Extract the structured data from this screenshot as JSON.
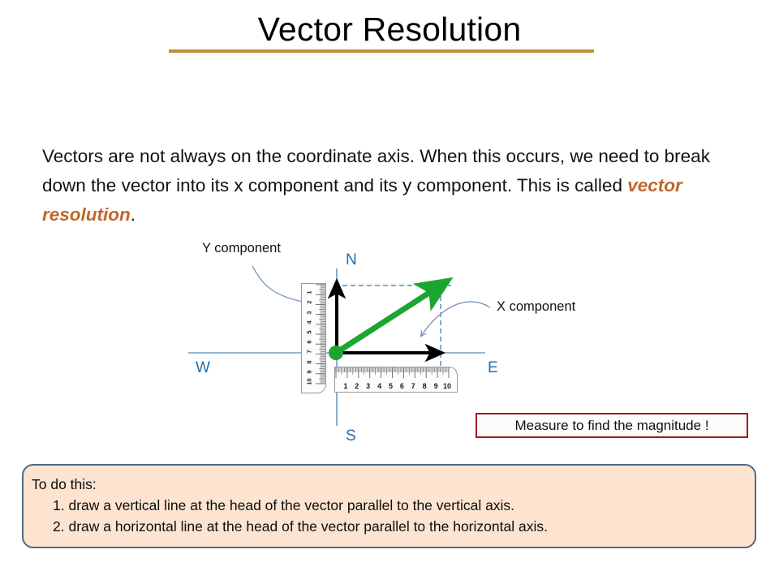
{
  "slide": {
    "title": "Vector Resolution",
    "title_rule_color": "#BF8F3E"
  },
  "body": {
    "text_part1": "Vectors are not always on the coordinate axis.  When this occurs, we need to break down the vector into its x component and its y component.  This is called ",
    "accent_text": "vector resolution",
    "text_part2": ".",
    "accent_color": "#C0662A"
  },
  "diagram": {
    "compass": {
      "north": "N",
      "south": "S",
      "west": "W",
      "east": "E",
      "color": "#1F6FB5"
    },
    "callouts": {
      "y_component": "Y component",
      "x_component": "X component"
    },
    "vector": {
      "color": "#1DA532",
      "origin_dot_color": "#1DA532",
      "component_arrow_color": "#000000",
      "guide_line_color": "#3A6FA8"
    },
    "ruler_vertical": {
      "ticks": [
        "1",
        "2",
        "3",
        "4",
        "5",
        "6",
        "7",
        "8",
        "9",
        "10"
      ]
    },
    "ruler_horizontal": {
      "ticks": [
        "1",
        "2",
        "3",
        "4",
        "5",
        "6",
        "7",
        "8",
        "9",
        "10"
      ]
    }
  },
  "measure_box": {
    "text": "Measure to find the magnitude !",
    "border_color": "#9E1B22"
  },
  "instructions": {
    "heading": "To do this:",
    "step1": "1.  draw a vertical line at the head of the vector parallel to the vertical axis.",
    "step2": "2. draw a horizontal line at the head of the vector parallel to the horizontal axis.",
    "background_color": "#FCE4D0",
    "border_color": "#4A6A8A"
  }
}
